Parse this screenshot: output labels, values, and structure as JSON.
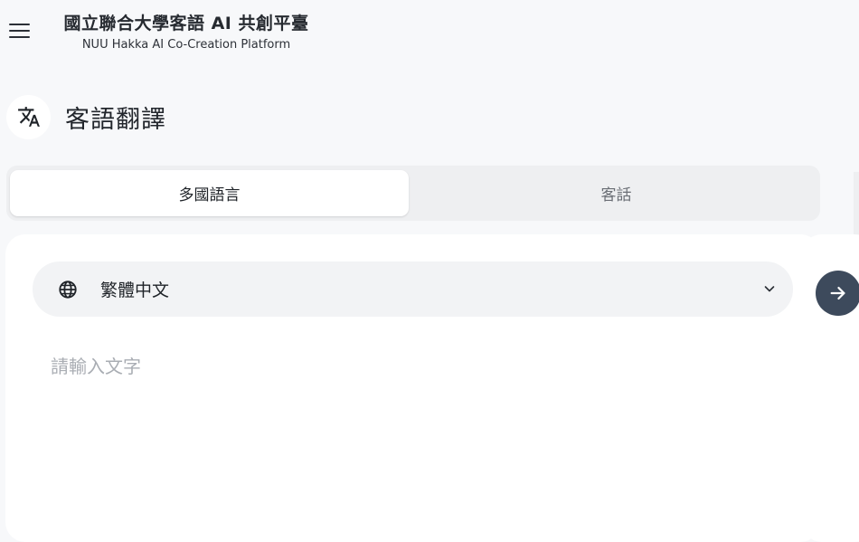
{
  "header": {
    "menu_icon": "hamburger-menu-icon",
    "title": "國立聯合大學客語 AI 共創平臺",
    "subtitle": "NUU Hakka AI Co-Creation Platform"
  },
  "page": {
    "icon": "translate-icon",
    "title": "客語翻譯"
  },
  "tabs": [
    {
      "label": "多國語言",
      "active": true
    },
    {
      "label": "客話",
      "active": false
    }
  ],
  "translator": {
    "language_icon": "globe-icon",
    "language_value": "繁體中文",
    "dropdown_icon": "chevron-down-icon",
    "input_placeholder": "請輸入文字",
    "input_value": "",
    "go_icon": "arrow-right-icon"
  },
  "colors": {
    "background": "#f7f8fa",
    "card": "#ffffff",
    "select_bg": "#f2f3f5",
    "go_button": "#3d4a5c",
    "placeholder": "#a9adb3"
  }
}
